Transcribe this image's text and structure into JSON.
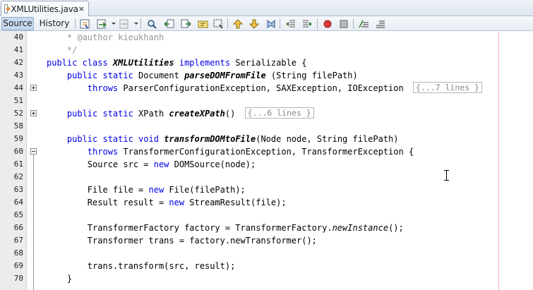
{
  "tab": {
    "filename": "XMLUtilities.java",
    "close_glyph": "×"
  },
  "toolbar": {
    "source_label": "Source",
    "history_label": "History"
  },
  "editor": {
    "right_margin_color": "#f0b3b3",
    "lines": [
      {
        "num": "40",
        "fold": "",
        "segments": [
          {
            "t": "    * @author kieukhanh",
            "c": "cm"
          }
        ]
      },
      {
        "num": "41",
        "fold": "",
        "segments": [
          {
            "t": "    */",
            "c": "cm"
          }
        ]
      },
      {
        "num": "42",
        "fold": "",
        "segments": [
          {
            "t": "public class ",
            "c": "kw"
          },
          {
            "t": "XMLUtilities ",
            "c": "mb"
          },
          {
            "t": "implements ",
            "c": "kw"
          },
          {
            "t": "Serializable {",
            "c": ""
          }
        ]
      },
      {
        "num": "43",
        "fold": "",
        "segments": [
          {
            "t": "    public static ",
            "c": "kw"
          },
          {
            "t": "Document ",
            "c": ""
          },
          {
            "t": "parseDOMFromFile",
            "c": "mb"
          },
          {
            "t": " (String filePath)",
            "c": ""
          }
        ]
      },
      {
        "num": "44",
        "fold": "plus",
        "segments": [
          {
            "t": "        throws ",
            "c": "kw"
          },
          {
            "t": "ParserConfigurationException, SAXException, IOException ",
            "c": ""
          },
          {
            "t": "{...7 lines }",
            "c": "collapsed"
          }
        ]
      },
      {
        "num": "51",
        "fold": "",
        "segments": []
      },
      {
        "num": "52",
        "fold": "plus",
        "segments": [
          {
            "t": "    public static ",
            "c": "kw"
          },
          {
            "t": "XPath ",
            "c": ""
          },
          {
            "t": "createXPath",
            "c": "mb"
          },
          {
            "t": "() ",
            "c": ""
          },
          {
            "t": "{...6 lines }",
            "c": "collapsed"
          }
        ]
      },
      {
        "num": "58",
        "fold": "",
        "segments": []
      },
      {
        "num": "59",
        "fold": "",
        "segments": [
          {
            "t": "    public static void ",
            "c": "kw"
          },
          {
            "t": "transformDOMtoFile",
            "c": "mb"
          },
          {
            "t": "(Node node, String filePath)",
            "c": ""
          }
        ]
      },
      {
        "num": "60",
        "fold": "minus",
        "segments": [
          {
            "t": "        throws ",
            "c": "kw"
          },
          {
            "t": "TransformerConfigurationException, TransformerException {",
            "c": ""
          }
        ]
      },
      {
        "num": "61",
        "fold": "",
        "segments": [
          {
            "t": "        Source src = ",
            "c": ""
          },
          {
            "t": "new ",
            "c": "kw"
          },
          {
            "t": "DOMSource(node);",
            "c": ""
          }
        ]
      },
      {
        "num": "62",
        "fold": "",
        "segments": []
      },
      {
        "num": "63",
        "fold": "",
        "segments": [
          {
            "t": "        File file = ",
            "c": ""
          },
          {
            "t": "new ",
            "c": "kw"
          },
          {
            "t": "File(filePath);",
            "c": ""
          }
        ]
      },
      {
        "num": "64",
        "fold": "",
        "segments": [
          {
            "t": "        Result result = ",
            "c": ""
          },
          {
            "t": "new ",
            "c": "kw"
          },
          {
            "t": "StreamResult(file);",
            "c": ""
          }
        ]
      },
      {
        "num": "65",
        "fold": "",
        "segments": []
      },
      {
        "num": "66",
        "fold": "",
        "segments": [
          {
            "t": "        TransformerFactory factory = TransformerFactory.",
            "c": ""
          },
          {
            "t": "newInstance",
            "c": "st"
          },
          {
            "t": "();",
            "c": ""
          }
        ]
      },
      {
        "num": "67",
        "fold": "",
        "segments": [
          {
            "t": "        Transformer trans = factory.newTransformer();",
            "c": ""
          }
        ]
      },
      {
        "num": "68",
        "fold": "",
        "segments": []
      },
      {
        "num": "69",
        "fold": "",
        "segments": [
          {
            "t": "        trans.transform(src, result);",
            "c": ""
          }
        ]
      },
      {
        "num": "70",
        "fold": "",
        "segments": [
          {
            "t": "    }",
            "c": ""
          }
        ]
      }
    ]
  }
}
